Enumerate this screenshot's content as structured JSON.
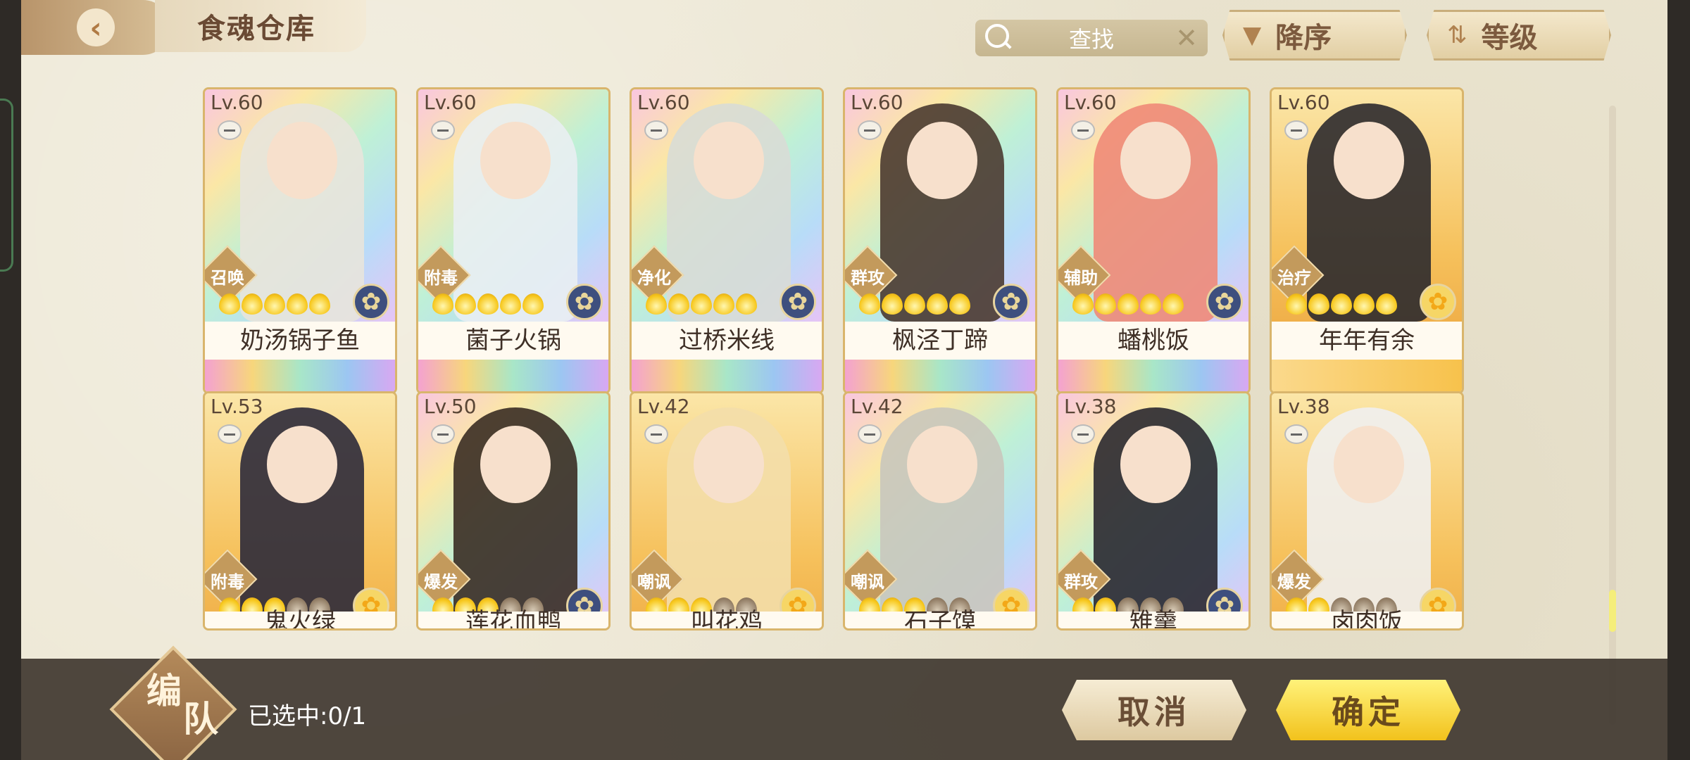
{
  "header": {
    "title": "食魂仓库",
    "search_placeholder": "查找",
    "sort_order_label": "降序",
    "sort_by_label": "等级"
  },
  "cards": [
    {
      "level": "Lv.60",
      "role": "召唤",
      "name": "奶汤锅子鱼",
      "stars": 5,
      "element": "blue",
      "frame": "rainbow",
      "hair": "#e8e4dc"
    },
    {
      "level": "Lv.60",
      "role": "附毒",
      "name": "菌子火锅",
      "stars": 5,
      "element": "blue",
      "frame": "rainbow",
      "hair": "#e9eef2"
    },
    {
      "level": "Lv.60",
      "role": "净化",
      "name": "过桥米线",
      "stars": 5,
      "element": "blue",
      "frame": "rainbow",
      "hair": "#d8dcd6"
    },
    {
      "level": "Lv.60",
      "role": "群攻",
      "name": "枫泾丁蹄",
      "stars": 5,
      "element": "blue",
      "frame": "rainbow",
      "hair": "#4a3a30"
    },
    {
      "level": "Lv.60",
      "role": "辅助",
      "name": "蟠桃饭",
      "stars": 5,
      "element": "blue",
      "frame": "rainbow",
      "hair": "#f08a78"
    },
    {
      "level": "Lv.60",
      "role": "治疗",
      "name": "年年有余",
      "stars": 5,
      "element": "gold",
      "frame": "gold",
      "hair": "#2c2a2e"
    },
    {
      "level": "Lv.53",
      "role": "附毒",
      "name": "鬼火绿",
      "stars": 3,
      "element": "gold",
      "frame": "gold",
      "hair": "#2c2a3a"
    },
    {
      "level": "Lv.50",
      "role": "爆发",
      "name": "莲花血鸭",
      "stars": 3,
      "element": "blue",
      "frame": "rainbow",
      "hair": "#3a2c24"
    },
    {
      "level": "Lv.42",
      "role": "嘲讽",
      "name": "叫花鸡",
      "stars": 3,
      "element": "gold",
      "frame": "gold",
      "hair": "#f3deaa"
    },
    {
      "level": "Lv.42",
      "role": "嘲讽",
      "name": "石子馍",
      "stars": 3,
      "element": "gold",
      "frame": "rainbow",
      "hair": "#c9c6bc"
    },
    {
      "level": "Lv.38",
      "role": "群攻",
      "name": "雉羹",
      "stars": 2,
      "element": "blue",
      "frame": "rainbow",
      "hair": "#2a2830"
    },
    {
      "level": "Lv.38",
      "role": "爆发",
      "name": "卤肉饭",
      "stars": 2,
      "element": "gold",
      "frame": "gold",
      "hair": "#efefef"
    }
  ],
  "footer": {
    "team_label_1": "编",
    "team_label_2": "队",
    "selected_text": "已选中:0/1",
    "cancel_label": "取消",
    "confirm_label": "确定"
  },
  "colors": {
    "accent_gold": "#f2c21c",
    "panel_bg": "#ece6d2",
    "element_blue": "#3e4f7e",
    "element_gold": "#f6d666"
  }
}
